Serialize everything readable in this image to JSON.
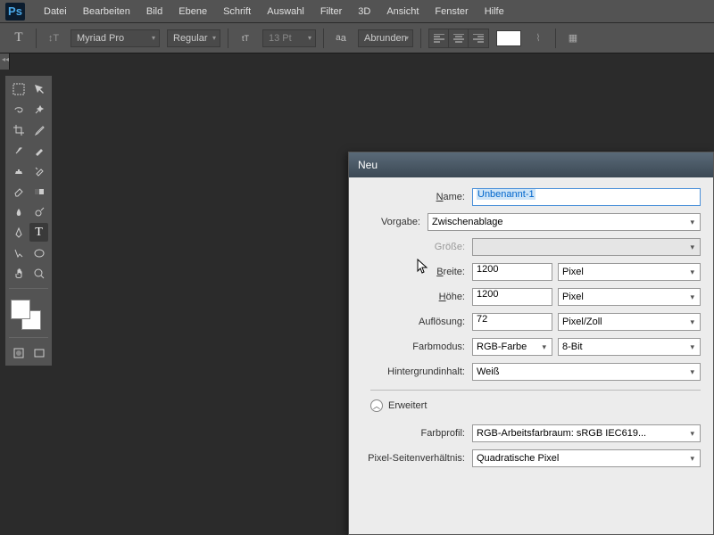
{
  "menubar": [
    "Datei",
    "Bearbeiten",
    "Bild",
    "Ebene",
    "Schrift",
    "Auswahl",
    "Filter",
    "3D",
    "Ansicht",
    "Fenster",
    "Hilfe"
  ],
  "optbar": {
    "font": "Myriad Pro",
    "weight": "Regular",
    "size": "13 Pt",
    "anti": "Abrunden"
  },
  "dialog": {
    "title": "Neu",
    "name_label": "Name:",
    "name": "Unbenannt-1",
    "preset_label": "Vorgabe:",
    "preset": "Zwischenablage",
    "size_label": "Größe:",
    "size": "",
    "width_label": "Breite:",
    "width": "1200",
    "width_unit": "Pixel",
    "height_label": "Höhe:",
    "height": "1200",
    "height_unit": "Pixel",
    "res_label": "Auflösung:",
    "res": "72",
    "res_unit": "Pixel/Zoll",
    "colormode_label": "Farbmodus:",
    "colormode": "RGB-Farbe",
    "bitdepth": "8-Bit",
    "bg_label": "Hintergrundinhalt:",
    "bg": "Weiß",
    "advanced": "Erweitert",
    "profile_label": "Farbprofil:",
    "profile": "RGB-Arbeitsfarbraum:  sRGB IEC619...",
    "aspect_label": "Pixel-Seitenverhältnis:",
    "aspect": "Quadratische Pixel"
  }
}
